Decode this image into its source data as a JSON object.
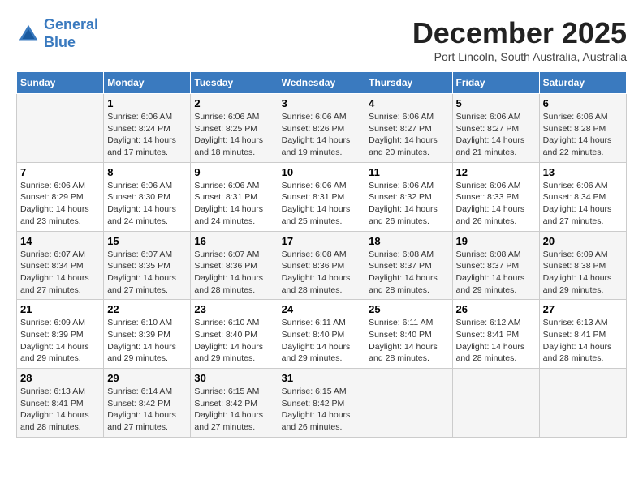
{
  "header": {
    "logo_line1": "General",
    "logo_line2": "Blue",
    "month_title": "December 2025",
    "subtitle": "Port Lincoln, South Australia, Australia"
  },
  "weekdays": [
    "Sunday",
    "Monday",
    "Tuesday",
    "Wednesday",
    "Thursday",
    "Friday",
    "Saturday"
  ],
  "weeks": [
    [
      {
        "day": "",
        "info": ""
      },
      {
        "day": "1",
        "info": "Sunrise: 6:06 AM\nSunset: 8:24 PM\nDaylight: 14 hours\nand 17 minutes."
      },
      {
        "day": "2",
        "info": "Sunrise: 6:06 AM\nSunset: 8:25 PM\nDaylight: 14 hours\nand 18 minutes."
      },
      {
        "day": "3",
        "info": "Sunrise: 6:06 AM\nSunset: 8:26 PM\nDaylight: 14 hours\nand 19 minutes."
      },
      {
        "day": "4",
        "info": "Sunrise: 6:06 AM\nSunset: 8:27 PM\nDaylight: 14 hours\nand 20 minutes."
      },
      {
        "day": "5",
        "info": "Sunrise: 6:06 AM\nSunset: 8:27 PM\nDaylight: 14 hours\nand 21 minutes."
      },
      {
        "day": "6",
        "info": "Sunrise: 6:06 AM\nSunset: 8:28 PM\nDaylight: 14 hours\nand 22 minutes."
      }
    ],
    [
      {
        "day": "7",
        "info": "Sunrise: 6:06 AM\nSunset: 8:29 PM\nDaylight: 14 hours\nand 23 minutes."
      },
      {
        "day": "8",
        "info": "Sunrise: 6:06 AM\nSunset: 8:30 PM\nDaylight: 14 hours\nand 24 minutes."
      },
      {
        "day": "9",
        "info": "Sunrise: 6:06 AM\nSunset: 8:31 PM\nDaylight: 14 hours\nand 24 minutes."
      },
      {
        "day": "10",
        "info": "Sunrise: 6:06 AM\nSunset: 8:31 PM\nDaylight: 14 hours\nand 25 minutes."
      },
      {
        "day": "11",
        "info": "Sunrise: 6:06 AM\nSunset: 8:32 PM\nDaylight: 14 hours\nand 26 minutes."
      },
      {
        "day": "12",
        "info": "Sunrise: 6:06 AM\nSunset: 8:33 PM\nDaylight: 14 hours\nand 26 minutes."
      },
      {
        "day": "13",
        "info": "Sunrise: 6:06 AM\nSunset: 8:34 PM\nDaylight: 14 hours\nand 27 minutes."
      }
    ],
    [
      {
        "day": "14",
        "info": "Sunrise: 6:07 AM\nSunset: 8:34 PM\nDaylight: 14 hours\nand 27 minutes."
      },
      {
        "day": "15",
        "info": "Sunrise: 6:07 AM\nSunset: 8:35 PM\nDaylight: 14 hours\nand 27 minutes."
      },
      {
        "day": "16",
        "info": "Sunrise: 6:07 AM\nSunset: 8:36 PM\nDaylight: 14 hours\nand 28 minutes."
      },
      {
        "day": "17",
        "info": "Sunrise: 6:08 AM\nSunset: 8:36 PM\nDaylight: 14 hours\nand 28 minutes."
      },
      {
        "day": "18",
        "info": "Sunrise: 6:08 AM\nSunset: 8:37 PM\nDaylight: 14 hours\nand 28 minutes."
      },
      {
        "day": "19",
        "info": "Sunrise: 6:08 AM\nSunset: 8:37 PM\nDaylight: 14 hours\nand 29 minutes."
      },
      {
        "day": "20",
        "info": "Sunrise: 6:09 AM\nSunset: 8:38 PM\nDaylight: 14 hours\nand 29 minutes."
      }
    ],
    [
      {
        "day": "21",
        "info": "Sunrise: 6:09 AM\nSunset: 8:39 PM\nDaylight: 14 hours\nand 29 minutes."
      },
      {
        "day": "22",
        "info": "Sunrise: 6:10 AM\nSunset: 8:39 PM\nDaylight: 14 hours\nand 29 minutes."
      },
      {
        "day": "23",
        "info": "Sunrise: 6:10 AM\nSunset: 8:40 PM\nDaylight: 14 hours\nand 29 minutes."
      },
      {
        "day": "24",
        "info": "Sunrise: 6:11 AM\nSunset: 8:40 PM\nDaylight: 14 hours\nand 29 minutes."
      },
      {
        "day": "25",
        "info": "Sunrise: 6:11 AM\nSunset: 8:40 PM\nDaylight: 14 hours\nand 28 minutes."
      },
      {
        "day": "26",
        "info": "Sunrise: 6:12 AM\nSunset: 8:41 PM\nDaylight: 14 hours\nand 28 minutes."
      },
      {
        "day": "27",
        "info": "Sunrise: 6:13 AM\nSunset: 8:41 PM\nDaylight: 14 hours\nand 28 minutes."
      }
    ],
    [
      {
        "day": "28",
        "info": "Sunrise: 6:13 AM\nSunset: 8:41 PM\nDaylight: 14 hours\nand 28 minutes."
      },
      {
        "day": "29",
        "info": "Sunrise: 6:14 AM\nSunset: 8:42 PM\nDaylight: 14 hours\nand 27 minutes."
      },
      {
        "day": "30",
        "info": "Sunrise: 6:15 AM\nSunset: 8:42 PM\nDaylight: 14 hours\nand 27 minutes."
      },
      {
        "day": "31",
        "info": "Sunrise: 6:15 AM\nSunset: 8:42 PM\nDaylight: 14 hours\nand 26 minutes."
      },
      {
        "day": "",
        "info": ""
      },
      {
        "day": "",
        "info": ""
      },
      {
        "day": "",
        "info": ""
      }
    ]
  ]
}
